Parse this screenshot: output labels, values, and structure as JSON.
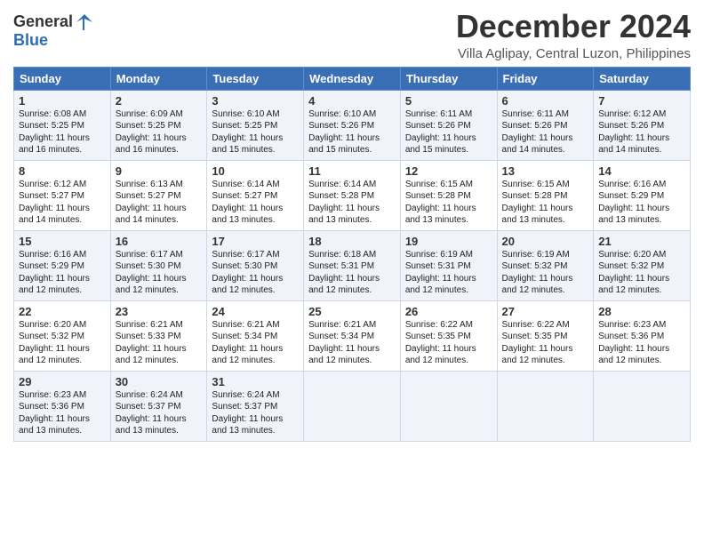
{
  "logo": {
    "general": "General",
    "blue": "Blue"
  },
  "header": {
    "month": "December 2024",
    "location": "Villa Aglipay, Central Luzon, Philippines"
  },
  "days_of_week": [
    "Sunday",
    "Monday",
    "Tuesday",
    "Wednesday",
    "Thursday",
    "Friday",
    "Saturday"
  ],
  "weeks": [
    [
      {
        "day": "1",
        "info": "Sunrise: 6:08 AM\nSunset: 5:25 PM\nDaylight: 11 hours\nand 16 minutes."
      },
      {
        "day": "2",
        "info": "Sunrise: 6:09 AM\nSunset: 5:25 PM\nDaylight: 11 hours\nand 16 minutes."
      },
      {
        "day": "3",
        "info": "Sunrise: 6:10 AM\nSunset: 5:25 PM\nDaylight: 11 hours\nand 15 minutes."
      },
      {
        "day": "4",
        "info": "Sunrise: 6:10 AM\nSunset: 5:26 PM\nDaylight: 11 hours\nand 15 minutes."
      },
      {
        "day": "5",
        "info": "Sunrise: 6:11 AM\nSunset: 5:26 PM\nDaylight: 11 hours\nand 15 minutes."
      },
      {
        "day": "6",
        "info": "Sunrise: 6:11 AM\nSunset: 5:26 PM\nDaylight: 11 hours\nand 14 minutes."
      },
      {
        "day": "7",
        "info": "Sunrise: 6:12 AM\nSunset: 5:26 PM\nDaylight: 11 hours\nand 14 minutes."
      }
    ],
    [
      {
        "day": "8",
        "info": "Sunrise: 6:12 AM\nSunset: 5:27 PM\nDaylight: 11 hours\nand 14 minutes."
      },
      {
        "day": "9",
        "info": "Sunrise: 6:13 AM\nSunset: 5:27 PM\nDaylight: 11 hours\nand 14 minutes."
      },
      {
        "day": "10",
        "info": "Sunrise: 6:14 AM\nSunset: 5:27 PM\nDaylight: 11 hours\nand 13 minutes."
      },
      {
        "day": "11",
        "info": "Sunrise: 6:14 AM\nSunset: 5:28 PM\nDaylight: 11 hours\nand 13 minutes."
      },
      {
        "day": "12",
        "info": "Sunrise: 6:15 AM\nSunset: 5:28 PM\nDaylight: 11 hours\nand 13 minutes."
      },
      {
        "day": "13",
        "info": "Sunrise: 6:15 AM\nSunset: 5:28 PM\nDaylight: 11 hours\nand 13 minutes."
      },
      {
        "day": "14",
        "info": "Sunrise: 6:16 AM\nSunset: 5:29 PM\nDaylight: 11 hours\nand 13 minutes."
      }
    ],
    [
      {
        "day": "15",
        "info": "Sunrise: 6:16 AM\nSunset: 5:29 PM\nDaylight: 11 hours\nand 12 minutes."
      },
      {
        "day": "16",
        "info": "Sunrise: 6:17 AM\nSunset: 5:30 PM\nDaylight: 11 hours\nand 12 minutes."
      },
      {
        "day": "17",
        "info": "Sunrise: 6:17 AM\nSunset: 5:30 PM\nDaylight: 11 hours\nand 12 minutes."
      },
      {
        "day": "18",
        "info": "Sunrise: 6:18 AM\nSunset: 5:31 PM\nDaylight: 11 hours\nand 12 minutes."
      },
      {
        "day": "19",
        "info": "Sunrise: 6:19 AM\nSunset: 5:31 PM\nDaylight: 11 hours\nand 12 minutes."
      },
      {
        "day": "20",
        "info": "Sunrise: 6:19 AM\nSunset: 5:32 PM\nDaylight: 11 hours\nand 12 minutes."
      },
      {
        "day": "21",
        "info": "Sunrise: 6:20 AM\nSunset: 5:32 PM\nDaylight: 11 hours\nand 12 minutes."
      }
    ],
    [
      {
        "day": "22",
        "info": "Sunrise: 6:20 AM\nSunset: 5:32 PM\nDaylight: 11 hours\nand 12 minutes."
      },
      {
        "day": "23",
        "info": "Sunrise: 6:21 AM\nSunset: 5:33 PM\nDaylight: 11 hours\nand 12 minutes."
      },
      {
        "day": "24",
        "info": "Sunrise: 6:21 AM\nSunset: 5:34 PM\nDaylight: 11 hours\nand 12 minutes."
      },
      {
        "day": "25",
        "info": "Sunrise: 6:21 AM\nSunset: 5:34 PM\nDaylight: 11 hours\nand 12 minutes."
      },
      {
        "day": "26",
        "info": "Sunrise: 6:22 AM\nSunset: 5:35 PM\nDaylight: 11 hours\nand 12 minutes."
      },
      {
        "day": "27",
        "info": "Sunrise: 6:22 AM\nSunset: 5:35 PM\nDaylight: 11 hours\nand 12 minutes."
      },
      {
        "day": "28",
        "info": "Sunrise: 6:23 AM\nSunset: 5:36 PM\nDaylight: 11 hours\nand 12 minutes."
      }
    ],
    [
      {
        "day": "29",
        "info": "Sunrise: 6:23 AM\nSunset: 5:36 PM\nDaylight: 11 hours\nand 13 minutes."
      },
      {
        "day": "30",
        "info": "Sunrise: 6:24 AM\nSunset: 5:37 PM\nDaylight: 11 hours\nand 13 minutes."
      },
      {
        "day": "31",
        "info": "Sunrise: 6:24 AM\nSunset: 5:37 PM\nDaylight: 11 hours\nand 13 minutes."
      },
      {
        "day": "",
        "info": ""
      },
      {
        "day": "",
        "info": ""
      },
      {
        "day": "",
        "info": ""
      },
      {
        "day": "",
        "info": ""
      }
    ]
  ]
}
